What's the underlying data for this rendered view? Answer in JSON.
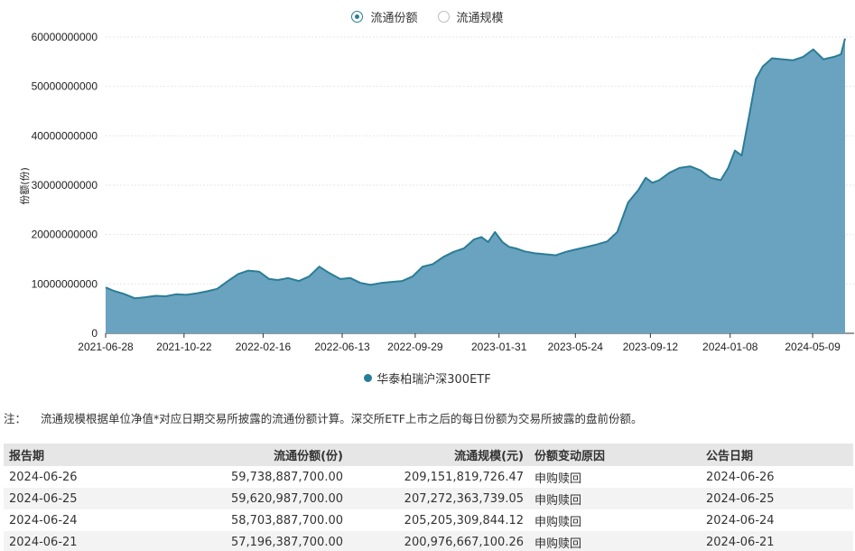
{
  "toggle": {
    "options": [
      "流通份额",
      "流通规模"
    ],
    "selected": 0
  },
  "chart_data": {
    "type": "area",
    "ylabel": "份额(份)",
    "ylim": [
      0,
      60000000000
    ],
    "yticks": [
      "0",
      "10000000000",
      "20000000000",
      "30000000000",
      "40000000000",
      "50000000000",
      "60000000000"
    ],
    "xticks": [
      "2021-06-28",
      "2021-10-22",
      "2022-02-16",
      "2022-06-13",
      "2022-09-29",
      "2023-01-31",
      "2023-05-24",
      "2023-09-12",
      "2024-01-08",
      "2024-05-09"
    ],
    "xlim": [
      "2021-06-28",
      "2024-06-26"
    ],
    "grid": true,
    "legend_position": "bottom-center",
    "color": "#2a7d96",
    "fill": "#6aa3bf",
    "series": [
      {
        "name": "华泰柏瑞沪深300ETF",
        "x": [
          "2021-06-28",
          "2021-07-10",
          "2021-07-25",
          "2021-08-10",
          "2021-08-25",
          "2021-09-10",
          "2021-09-25",
          "2021-10-10",
          "2021-10-25",
          "2021-11-10",
          "2021-11-25",
          "2021-12-10",
          "2021-12-25",
          "2022-01-10",
          "2022-01-25",
          "2022-02-10",
          "2022-02-25",
          "2022-03-10",
          "2022-03-25",
          "2022-04-10",
          "2022-04-25",
          "2022-05-10",
          "2022-05-25",
          "2022-06-10",
          "2022-06-25",
          "2022-07-10",
          "2022-07-25",
          "2022-08-10",
          "2022-08-25",
          "2022-09-10",
          "2022-09-25",
          "2022-10-10",
          "2022-10-25",
          "2022-11-10",
          "2022-11-25",
          "2022-12-10",
          "2022-12-25",
          "2023-01-05",
          "2023-01-15",
          "2023-01-25",
          "2023-02-05",
          "2023-02-15",
          "2023-02-25",
          "2023-03-10",
          "2023-03-25",
          "2023-04-10",
          "2023-04-25",
          "2023-05-10",
          "2023-05-25",
          "2023-06-10",
          "2023-06-25",
          "2023-07-10",
          "2023-07-25",
          "2023-08-10",
          "2023-08-25",
          "2023-09-05",
          "2023-09-15",
          "2023-09-25",
          "2023-10-10",
          "2023-10-25",
          "2023-11-10",
          "2023-11-25",
          "2023-12-10",
          "2023-12-25",
          "2024-01-05",
          "2024-01-15",
          "2024-01-25",
          "2024-02-05",
          "2024-02-15",
          "2024-02-25",
          "2024-03-10",
          "2024-03-25",
          "2024-04-10",
          "2024-04-25",
          "2024-05-10",
          "2024-05-25",
          "2024-06-10",
          "2024-06-20",
          "2024-06-26"
        ],
        "values": [
          9300000000,
          8600000000,
          8000000000,
          7100000000,
          7300000000,
          7600000000,
          7500000000,
          7900000000,
          7800000000,
          8100000000,
          8500000000,
          9000000000,
          10500000000,
          12000000000,
          12700000000,
          12500000000,
          11000000000,
          10800000000,
          11200000000,
          10600000000,
          11500000000,
          13500000000,
          12200000000,
          11000000000,
          11200000000,
          10200000000,
          9800000000,
          10200000000,
          10400000000,
          10600000000,
          11500000000,
          13500000000,
          14000000000,
          15500000000,
          16500000000,
          17200000000,
          19000000000,
          19500000000,
          18500000000,
          20500000000,
          18500000000,
          17500000000,
          17200000000,
          16600000000,
          16200000000,
          16000000000,
          15800000000,
          16500000000,
          17000000000,
          17500000000,
          18000000000,
          18600000000,
          20500000000,
          26500000000,
          29000000000,
          31500000000,
          30500000000,
          31000000000,
          32500000000,
          33500000000,
          33800000000,
          33000000000,
          31500000000,
          31000000000,
          33500000000,
          37000000000,
          36000000000,
          44000000000,
          51500000000,
          54000000000,
          55700000000,
          55500000000,
          55300000000,
          56000000000,
          57500000000,
          55500000000,
          56000000000,
          56500000000,
          59700000000
        ]
      }
    ]
  },
  "legend": {
    "label": "华泰柏瑞沪深300ETF"
  },
  "note": {
    "key": "注：",
    "text": "流通规模根据单位净值*对应日期交易所披露的流通份额计算。深交所ETF上市之后的每日份额为交易所披露的盘前份额。"
  },
  "table": {
    "headers": [
      "报告期",
      "流通份额(份)",
      "流通规模(元)",
      "份额变动原因",
      "公告日期"
    ],
    "rows": [
      [
        "2024-06-26",
        "59,738,887,700.00",
        "209,151,819,726.47",
        "申购赎回",
        "2024-06-26"
      ],
      [
        "2024-06-25",
        "59,620,987,700.00",
        "207,272,363,739.05",
        "申购赎回",
        "2024-06-25"
      ],
      [
        "2024-06-24",
        "58,703,887,700.00",
        "205,205,309,844.12",
        "申购赎回",
        "2024-06-24"
      ],
      [
        "2024-06-21",
        "57,196,387,700.00",
        "200,976,667,100.26",
        "申购赎回",
        "2024-06-21"
      ]
    ]
  }
}
